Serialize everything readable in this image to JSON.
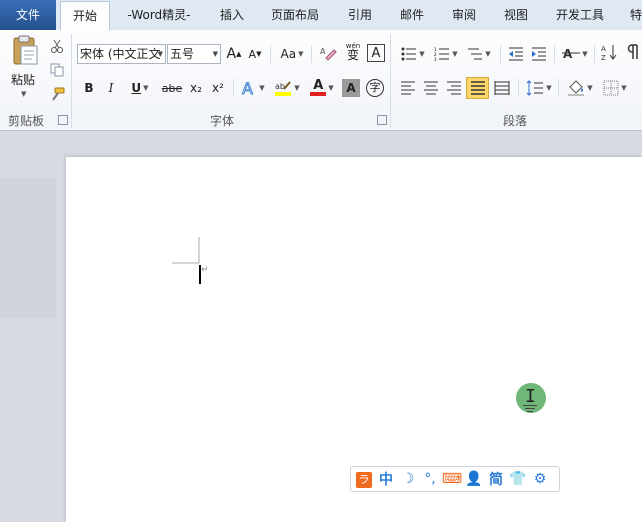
{
  "tabs": {
    "file": "文件",
    "home": "开始",
    "word_jingling": "-Word精灵-",
    "insert": "插入",
    "page_layout": "页面布局",
    "references": "引用",
    "mailings": "邮件",
    "review": "审阅",
    "view": "视图",
    "developer": "开发工具",
    "special": "特"
  },
  "clipboard": {
    "paste_label": "粘贴",
    "group_label": "剪贴板"
  },
  "font": {
    "font_name": "宋体 (中文正文",
    "font_size": "五号",
    "group_label": "字体",
    "grow": "A",
    "shrink": "A",
    "case": "Aa",
    "pinyin": "wén",
    "bold": "B",
    "italic": "I",
    "underline": "U",
    "strike": "abe",
    "subscript": "x₂",
    "superscript": "x²",
    "font_color_letter": "A",
    "char_shading": "A",
    "enclose": "字",
    "border_char": "A",
    "phonetic_char": "变"
  },
  "paragraph": {
    "group_label": "段落"
  },
  "ime": {
    "chinese": "中",
    "simplified": "简"
  },
  "colors": {
    "accent": "#2b5797",
    "highlight_yellow": "#ffff00",
    "font_red": "#e02020",
    "cursor_circle": "#5fae6a"
  }
}
